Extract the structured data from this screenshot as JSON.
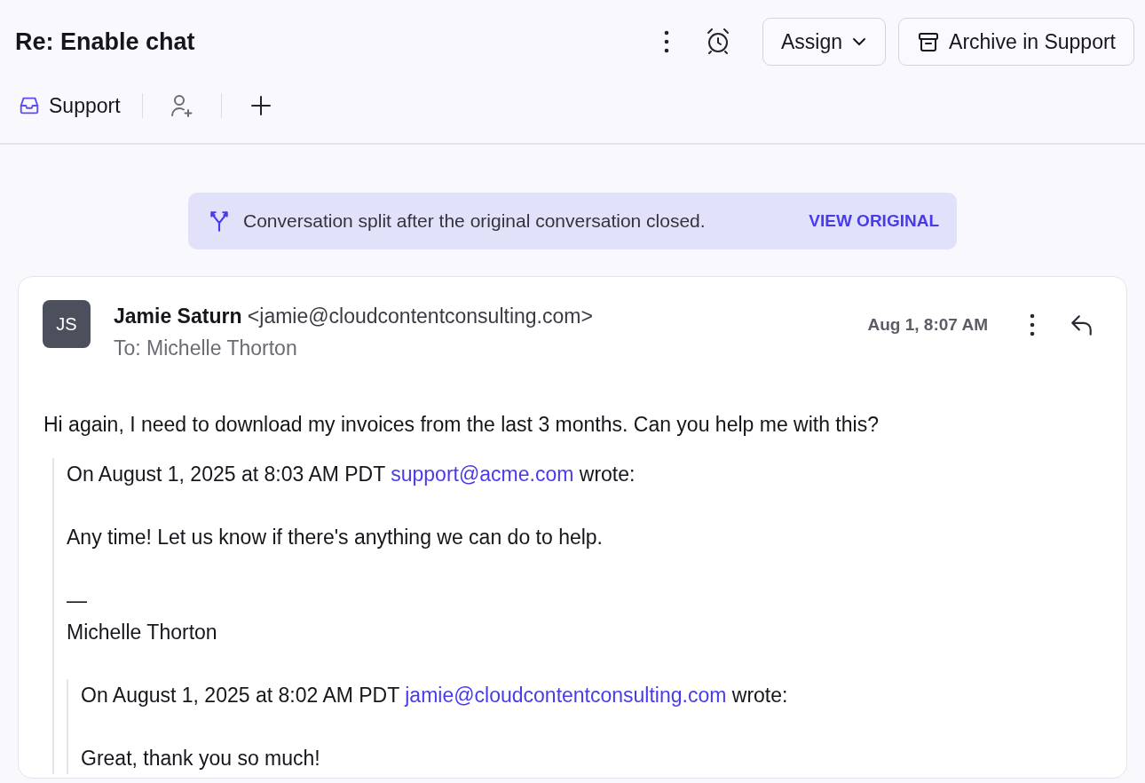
{
  "conversation": {
    "title": "Re: Enable chat",
    "assign_label": "Assign",
    "archive_label": "Archive in Support",
    "inbox": "Support"
  },
  "banner": {
    "text": "Conversation split after the original conversation closed.",
    "link": "VIEW ORIGINAL"
  },
  "message": {
    "avatar_initials": "JS",
    "sender_name": "Jamie Saturn",
    "sender_email": "<jamie@cloudcontentconsulting.com>",
    "recipient": "To: Michelle Thorton",
    "time": "Aug 1, 8:07 AM",
    "body": "Hi again, I need to download my invoices from the last 3 months. Can you help me with this?",
    "quote": {
      "header_prefix": "On August 1, 2025 at 8:03 AM PDT",
      "header_link": "support@acme.com",
      "header_suffix": "wrote:",
      "paragraphs": [
        [
          "Any time! Let us know if there's anything we can do to help."
        ],
        [
          "—",
          "Michelle Thorton"
        ]
      ],
      "quote": {
        "header_prefix": "On August 1, 2025 at 8:02 AM PDT",
        "header_link": "jamie@cloudcontentconsulting.com",
        "header_suffix": "wrote:",
        "paragraphs": [
          [
            "Great, thank you so much!"
          ]
        ]
      }
    }
  }
}
